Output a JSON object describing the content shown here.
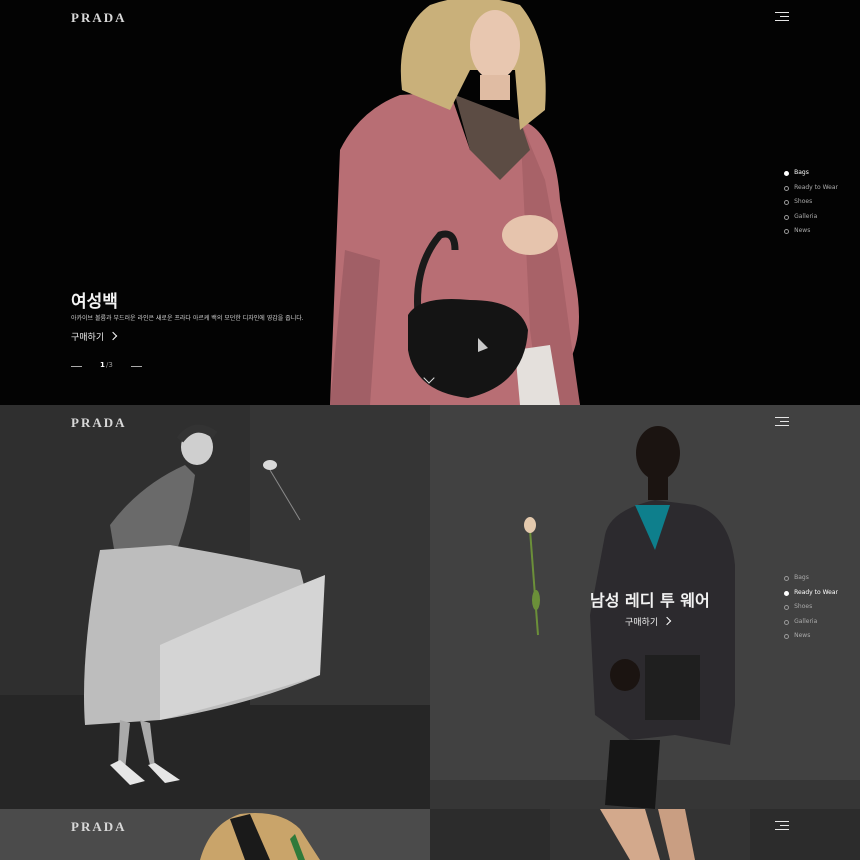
{
  "brand": "PRADA",
  "hero": {
    "title": "여성백",
    "description": "아카이브 볼륨과 부드러운 라인은 새로운 프라다 아르케 백의 모던한 디자인에 영감을 줍니다.",
    "cta": "구매하기",
    "page_current": "1",
    "page_total": "/3"
  },
  "nav_top": {
    "items": [
      {
        "label": "Bags",
        "active": true
      },
      {
        "label": "Ready to Wear",
        "active": false
      },
      {
        "label": "Shoes",
        "active": false
      },
      {
        "label": "Galleria",
        "active": false
      },
      {
        "label": "News",
        "active": false
      }
    ]
  },
  "section_two": {
    "title": "남성 레디 투 웨어",
    "cta": "구매하기"
  },
  "nav_mid": {
    "items": [
      {
        "label": "Bags",
        "active": false
      },
      {
        "label": "Ready to Wear",
        "active": true
      },
      {
        "label": "Shoes",
        "active": false
      },
      {
        "label": "Galleria",
        "active": false
      },
      {
        "label": "News",
        "active": false
      }
    ]
  },
  "colors": {
    "coat": "#b86e74",
    "background": "#000000",
    "panel_gray": "#3d3d3d"
  }
}
